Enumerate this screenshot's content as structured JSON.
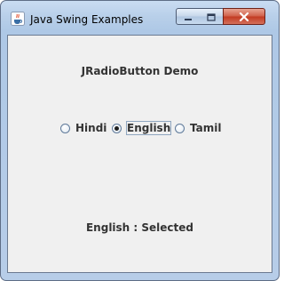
{
  "window": {
    "title": "Java Swing Examples",
    "app_icon": "java-cup-icon",
    "controls": {
      "minimize_icon": "minimize-icon",
      "maximize_icon": "maximize-icon",
      "close_icon": "close-icon"
    }
  },
  "content": {
    "heading": "JRadioButton Demo",
    "radio_options": [
      {
        "label": "Hindi",
        "selected": false
      },
      {
        "label": "English",
        "selected": true
      },
      {
        "label": "Tamil",
        "selected": false
      }
    ],
    "status_text": "English : Selected"
  },
  "colors": {
    "titlebar": "#b8cfe9",
    "close_button": "#c23a22",
    "client_background": "#f0f0f0",
    "text": "#333333"
  }
}
